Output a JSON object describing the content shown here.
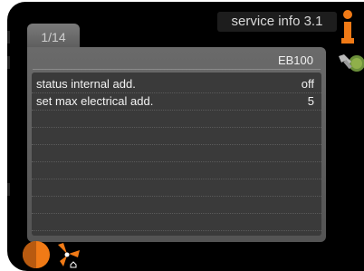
{
  "header": {
    "title": "service info 3.1"
  },
  "tab": {
    "label": "1/14"
  },
  "panel": {
    "subheader": "EB100"
  },
  "rows": [
    {
      "name": "status internal add.",
      "value": "off"
    },
    {
      "name": "set max electrical add.",
      "value": "5"
    }
  ],
  "empty_row_count": 7,
  "icons": {
    "info": "info-icon",
    "wrench": "wrench-icon",
    "temperature": "temperature-icon",
    "fan": "fan-icon"
  },
  "colors": {
    "accent_orange": "#f07a16",
    "background": "#000000",
    "panel": "#5f5f5f"
  }
}
